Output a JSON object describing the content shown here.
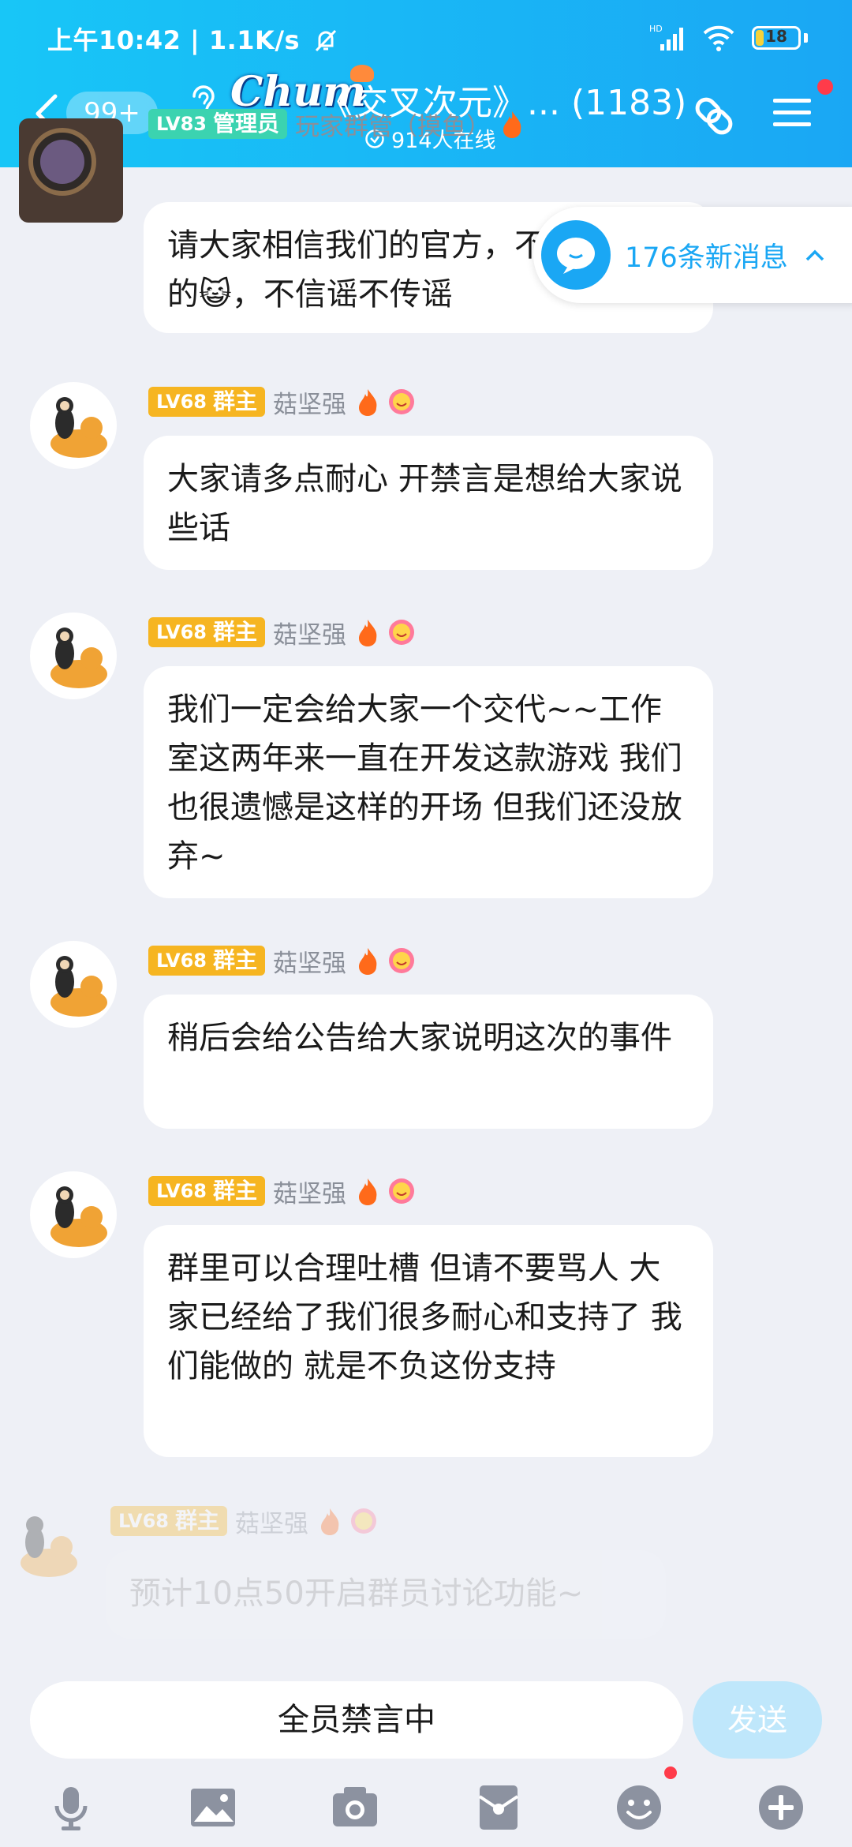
{
  "status": {
    "time": "上午10:42",
    "speed": "1.1K/s",
    "battery": "18",
    "battery_level": 0.18,
    "network": "HD"
  },
  "header": {
    "unread": "99+",
    "logo": "Chum",
    "title": "《交叉次元》... (1183)",
    "online": "914人在线"
  },
  "new_messages": "176条新消息",
  "messages": [
    {
      "level": "LV83",
      "role": "管理员",
      "role_color": "#3bd3b0",
      "name": "玩家群管（摸鱼）",
      "text": "请大家相信我们的官方，不可能跑路的😺，不信谣不传谣"
    },
    {
      "level": "LV68",
      "role": "群主",
      "name": "菇坚强",
      "text": "大家请多点耐心 开禁言是想给大家说些话"
    },
    {
      "level": "LV68",
      "role": "群主",
      "name": "菇坚强",
      "text": "我们一定会给大家一个交代~~工作室这两年来一直在开发这款游戏 我们也很遗憾是这样的开场 但我们还没放弃~"
    },
    {
      "level": "LV68",
      "role": "群主",
      "name": "菇坚强",
      "text": "稍后会给公告给大家说明这次的事件"
    },
    {
      "level": "LV68",
      "role": "群主",
      "name": "菇坚强",
      "text": "群里可以合理吐槽 但请不要骂人 大家已经给了我们很多耐心和支持了 我们能做的 就是不负这份支持"
    },
    {
      "level": "LV68",
      "role": "群主",
      "name": "菇坚强",
      "text": "预计10点50开启群员讨论功能~"
    }
  ],
  "input": {
    "muted_text": "全员禁言中",
    "send_label": "发送"
  },
  "toolbar": [
    "microphone-icon",
    "image-icon",
    "camera-icon",
    "red-packet-icon",
    "emoji-icon",
    "plus-icon"
  ],
  "colors": {
    "header": "#1aa7f4",
    "owner_badge": "#f6b521",
    "admin_badge": "#3bd3b0",
    "background": "#eef0f6"
  }
}
